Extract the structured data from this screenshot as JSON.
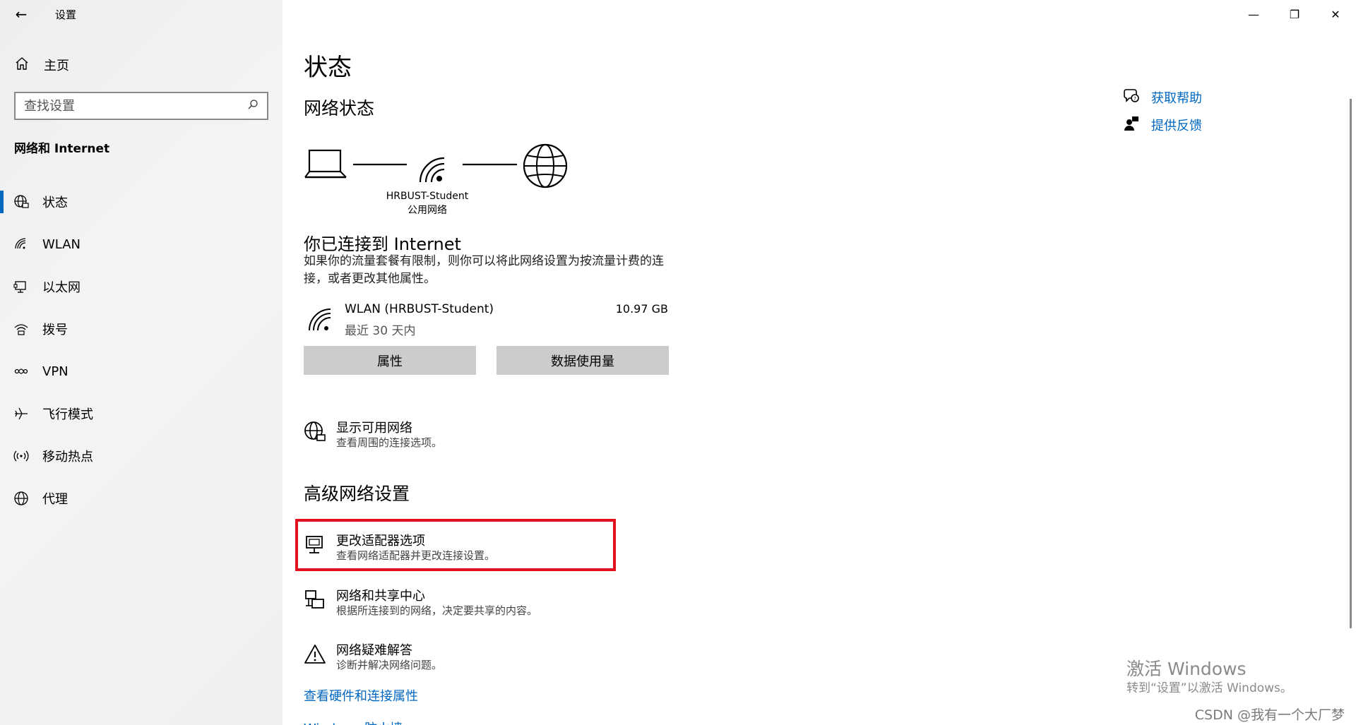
{
  "window": {
    "title": "设置"
  },
  "sidebar": {
    "home_label": "主页",
    "search_placeholder": "查找设置",
    "section_title": "网络和 Internet",
    "items": [
      {
        "label": "状态",
        "icon": "globe-network-icon",
        "active": true
      },
      {
        "label": "WLAN",
        "icon": "wifi-icon",
        "active": false
      },
      {
        "label": "以太网",
        "icon": "ethernet-icon",
        "active": false
      },
      {
        "label": "拨号",
        "icon": "dialup-icon",
        "active": false
      },
      {
        "label": "VPN",
        "icon": "vpn-icon",
        "active": false
      },
      {
        "label": "飞行模式",
        "icon": "airplane-icon",
        "active": false
      },
      {
        "label": "移动热点",
        "icon": "hotspot-icon",
        "active": false
      },
      {
        "label": "代理",
        "icon": "globe-icon",
        "active": false
      }
    ]
  },
  "main": {
    "title": "状态",
    "network_status_heading": "网络状态",
    "network_name": "HRBUST-Student",
    "network_type": "公用网络",
    "connected_title": "你已连接到 Internet",
    "connected_desc": "如果你的流量套餐有限制，则你可以将此网络设置为按流量计费的连接，或者更改其他属性。",
    "connection": {
      "name": "WLAN (HRBUST-Student)",
      "period": "最近 30 天内",
      "usage": "10.97 GB"
    },
    "buttons": {
      "properties": "属性",
      "data_usage": "数据使用量"
    },
    "show_networks": {
      "title": "显示可用网络",
      "subtitle": "查看周围的连接选项。"
    },
    "advanced_heading": "高级网络设置",
    "advanced": [
      {
        "title": "更改适配器选项",
        "subtitle": "查看网络适配器并更改连接设置。"
      },
      {
        "title": "网络和共享中心",
        "subtitle": "根据所连接到的网络，决定要共享的内容。"
      },
      {
        "title": "网络疑难解答",
        "subtitle": "诊断并解决网络问题。"
      }
    ],
    "hardware_link": "查看硬件和连接属性",
    "firewall_link": "Windows 防火墙"
  },
  "help": {
    "get_help": "获取帮助",
    "feedback": "提供反馈"
  },
  "watermark": {
    "line1": "激活 Windows",
    "line2": "转到“设置”以激活 Windows。"
  },
  "csdn": "CSDN @我有一个大厂梦",
  "colors": {
    "accent": "#0067c0",
    "highlight": "#e0121f"
  }
}
